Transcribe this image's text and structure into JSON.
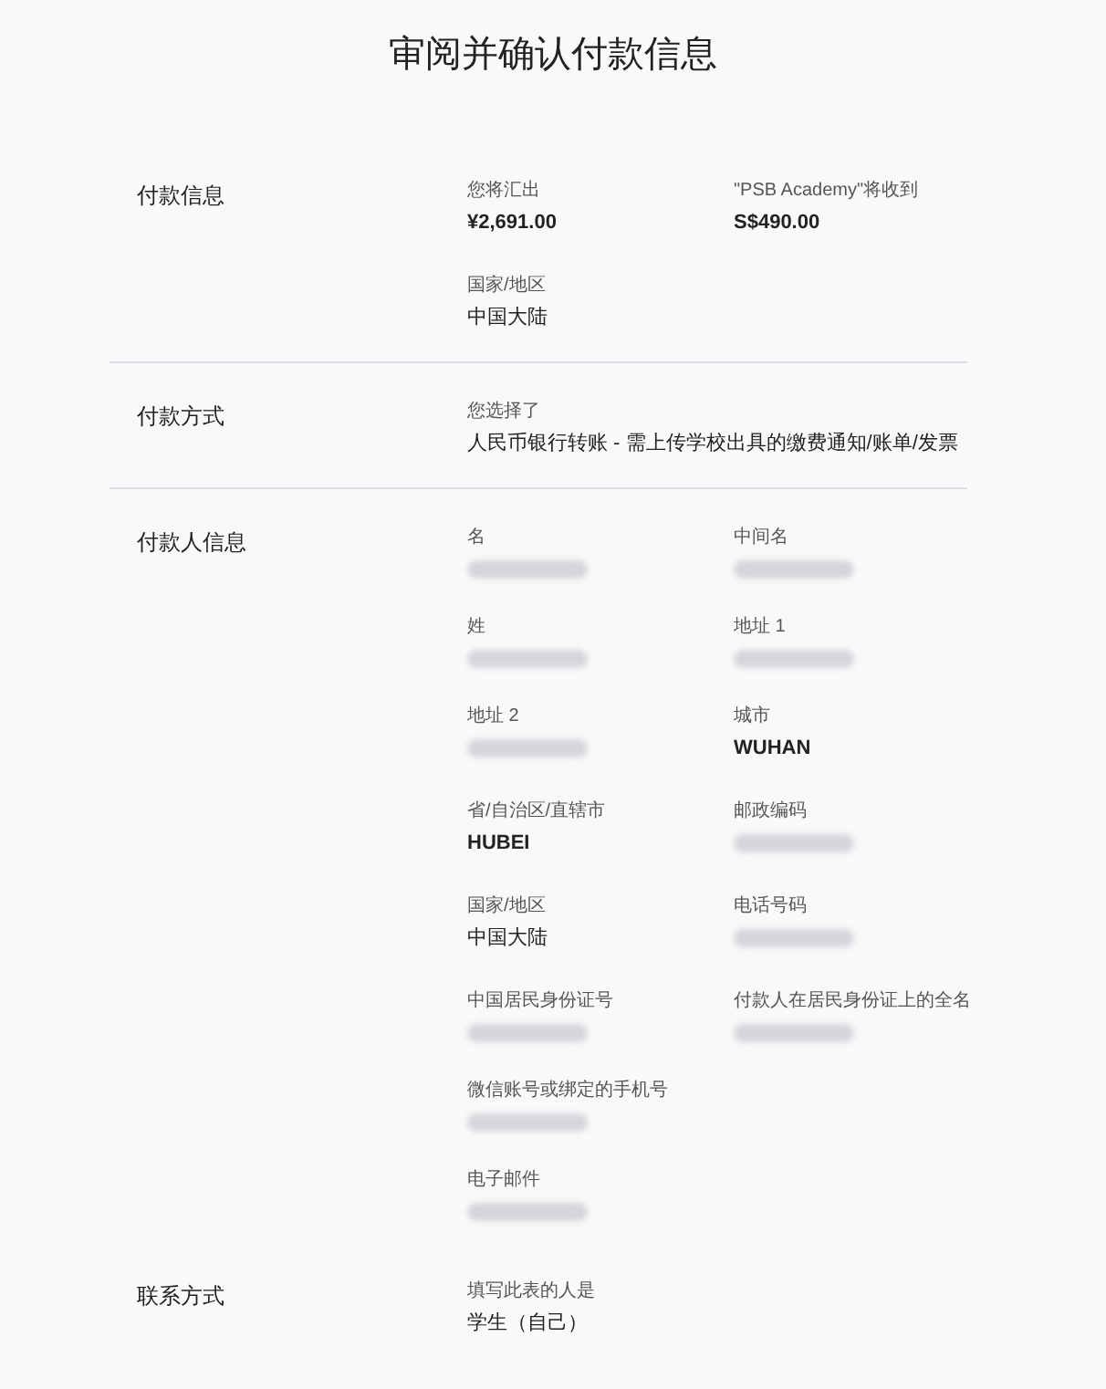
{
  "title": "审阅并确认付款信息",
  "sections": [
    {
      "title": "付款信息",
      "divider_after": true,
      "rows": [
        [
          {
            "label": "您将汇出",
            "kind": "text",
            "value": "¥2,691.00",
            "bold": true
          },
          {
            "label": "\"PSB Academy\"将收到",
            "kind": "text",
            "value": "S$490.00",
            "bold": true
          }
        ],
        [
          {
            "label": "国家/地区",
            "kind": "text",
            "value": "中国大陆",
            "bold": false
          }
        ]
      ]
    },
    {
      "title": "付款方式",
      "divider_after": true,
      "rows": [
        [
          {
            "label": "您选择了",
            "kind": "text",
            "value": "人民币银行转账 - 需上传学校出具的缴费通知/账单/发票",
            "bold": false
          }
        ]
      ]
    },
    {
      "title": "付款人信息",
      "divider_after": false,
      "rows": [
        [
          {
            "label": "名",
            "kind": "redacted"
          },
          {
            "label": "中间名",
            "kind": "redacted"
          }
        ],
        [
          {
            "label": "姓",
            "kind": "redacted"
          },
          {
            "label": "地址 1",
            "kind": "redacted"
          }
        ],
        [
          {
            "label": "地址 2",
            "kind": "redacted"
          },
          {
            "label": "城市",
            "kind": "text",
            "value": "WUHAN",
            "bold": true
          }
        ],
        [
          {
            "label": "省/自治区/直辖市",
            "kind": "text",
            "value": "HUBEI",
            "bold": true
          },
          {
            "label": "邮政编码",
            "kind": "redacted"
          }
        ],
        [
          {
            "label": "国家/地区",
            "kind": "text",
            "value": "中国大陆",
            "bold": false
          },
          {
            "label": "电话号码",
            "kind": "redacted"
          }
        ],
        [
          {
            "label": "中国居民身份证号",
            "kind": "redacted"
          },
          {
            "label": "付款人在居民身份证上的全名",
            "kind": "redacted"
          }
        ],
        [
          {
            "label": "微信账号或绑定的手机号",
            "kind": "redacted"
          }
        ],
        [
          {
            "label": "电子邮件",
            "kind": "redacted"
          }
        ]
      ]
    },
    {
      "title": "联系方式",
      "divider_after": false,
      "rows": [
        [
          {
            "label": "填写此表的人是",
            "kind": "text",
            "value": "学生（自己）",
            "bold": false
          }
        ]
      ]
    }
  ]
}
